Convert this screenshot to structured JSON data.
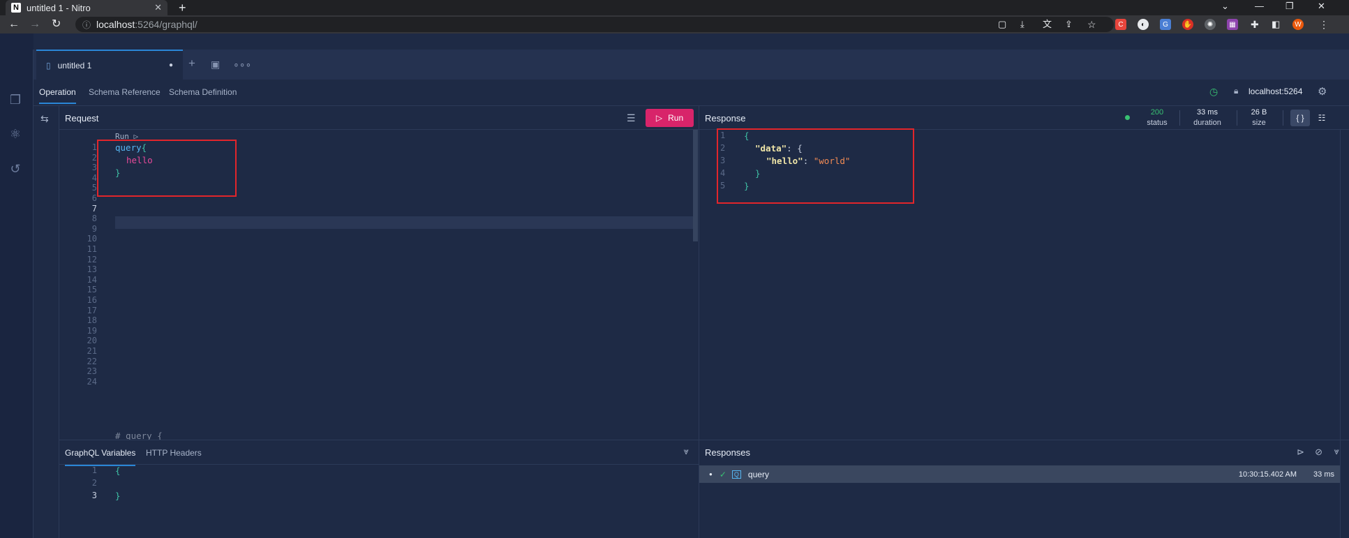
{
  "browser": {
    "tab_title": "untitled 1 - Nitro",
    "tab_favicon": "N",
    "url_host": "localhost",
    "url_path": ":5264/graphql/"
  },
  "app": {
    "doc_tab_label": "untitled 1",
    "op_tabs": [
      "Operation",
      "Schema Reference",
      "Schema Definition"
    ],
    "connection": "localhost:5264",
    "request_title": "Request",
    "run_label": "Run",
    "code_lens": "Run ▷",
    "response_title": "Response",
    "status": {
      "value": "200",
      "label": "status"
    },
    "duration": {
      "value": "33 ms",
      "label": "duration"
    },
    "size": {
      "value": "26 B",
      "label": "size"
    },
    "variables_tab": "GraphQL Variables",
    "headers_tab": "HTTP Headers",
    "responses_title": "Responses",
    "history_row": {
      "name": "query",
      "time": "10:30:15.402 AM",
      "duration": "33 ms"
    }
  },
  "editor": {
    "line_numbers": [
      "1",
      "2",
      "3",
      "4",
      "5",
      "6",
      "7",
      "8",
      "9",
      "10",
      "11",
      "12",
      "13",
      "14",
      "15",
      "16",
      "17",
      "18",
      "19",
      "20",
      "21",
      "22",
      "23",
      "24"
    ],
    "query_keyword": "query",
    "open_brace": "{",
    "field": "hello",
    "close_brace": "}",
    "trailing_comment": "# query {"
  },
  "response_json": {
    "line_numbers": [
      "1",
      "2",
      "3",
      "4",
      "5"
    ],
    "open": "{",
    "data_key": "\"data\"",
    "colon_brace": ": {",
    "hello_key": "\"hello\"",
    "colon": ": ",
    "hello_value": "\"world\"",
    "inner_close": "}",
    "outer_close": "}"
  },
  "variables_editor": {
    "line_numbers": [
      "1",
      "2",
      "3"
    ],
    "open": "{",
    "close": "}"
  },
  "colors": {
    "accent": "#2a86d6",
    "run_button": "#d8246a",
    "status_ok": "#38c172",
    "annotation_box": "#e2252b"
  }
}
